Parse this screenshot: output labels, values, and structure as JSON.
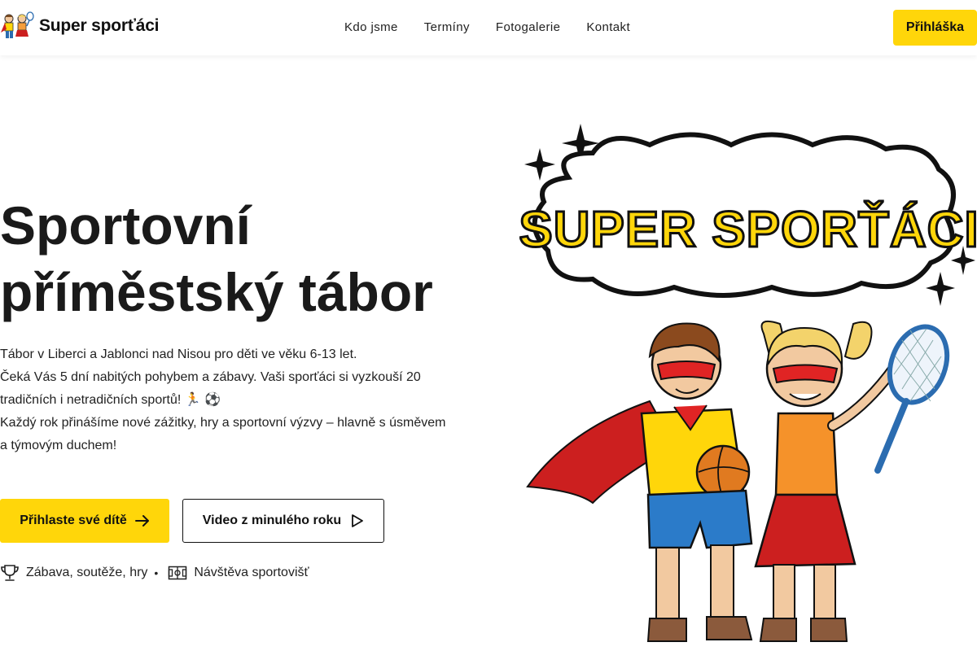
{
  "header": {
    "brand": "Super sporťáci",
    "nav": [
      "Kdo jsme",
      "Termíny",
      "Fotogalerie",
      "Kontakt"
    ],
    "cta": "Přihláška"
  },
  "hero": {
    "title_line1": "Sportovní",
    "title_line2": "příměstský tábor",
    "desc": [
      "Tábor v Liberci a Jablonci nad Nisou pro děti ve věku 6-13 let.",
      "Čeká Vás 5 dní nabitých pohybem a zábavy. Vaši sporťáci si vyzkouší 20 tradičních i netradičních sportů! 🏃 ⚽",
      "Každý rok přinášíme nové zážitky, hry a sportovní výzvy – hlavně s úsměvem a týmovým duchem!"
    ],
    "btn_primary": "Přihlaste své dítě",
    "btn_video": "Video z minulého roku",
    "features": [
      "Zábava, soutěže, hry",
      "Návštěva sportovišť"
    ]
  },
  "illustration": {
    "banner_text": "SUPER SPORŤÁCI"
  },
  "colors": {
    "accent": "#ffd60a",
    "cape": "#cc1f1f",
    "text": "#1a1a1a"
  }
}
